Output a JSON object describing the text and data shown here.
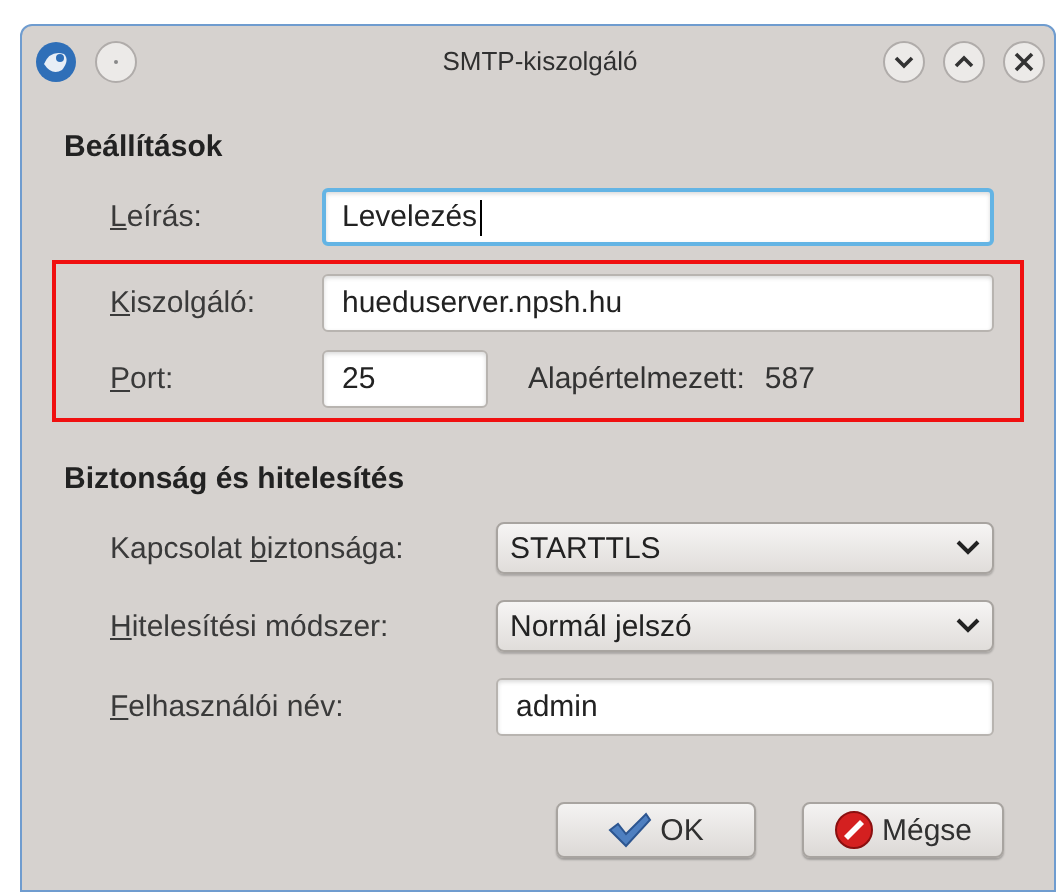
{
  "window": {
    "title": "SMTP-kiszolgáló"
  },
  "sections": [
    {
      "heading": "Beállítások",
      "groups": [
        {
          "highlighted": false,
          "rows": [
            {
              "kind": "text",
              "label": {
                "key": "L",
                "rest": "eírás:"
              },
              "value": "Levelezés",
              "focused": true
            }
          ]
        },
        {
          "highlighted": true,
          "rows": [
            {
              "kind": "text",
              "label": {
                "key": "K",
                "rest": "iszolgáló:"
              },
              "value": "hueduserver.npsh.hu",
              "focused": false
            },
            {
              "kind": "port",
              "label": {
                "key": "P",
                "rest": "ort:"
              },
              "value": "25",
              "focused": false,
              "default_label": "Alapértelmezett:",
              "default_value": "587"
            }
          ]
        }
      ]
    },
    {
      "heading": "Biztonság és hitelesítés",
      "groups": [
        {
          "highlighted": false,
          "rows": [
            {
              "kind": "combo",
              "label": {
                "before": "Kapcsolat ",
                "key": "b",
                "rest": "iztonsága:"
              },
              "value": "STARTTLS"
            },
            {
              "kind": "combo",
              "label": {
                "key": "H",
                "rest": "itelesítési módszer:"
              },
              "value": "Normál jelszó"
            },
            {
              "kind": "text",
              "label": {
                "key": "F",
                "rest": "elhasználói név:"
              },
              "value": "admin",
              "focused": false
            }
          ]
        }
      ]
    }
  ],
  "buttons": [
    {
      "kind": "ok",
      "label": "OK"
    },
    {
      "kind": "cancel",
      "label": "Mégse"
    }
  ]
}
